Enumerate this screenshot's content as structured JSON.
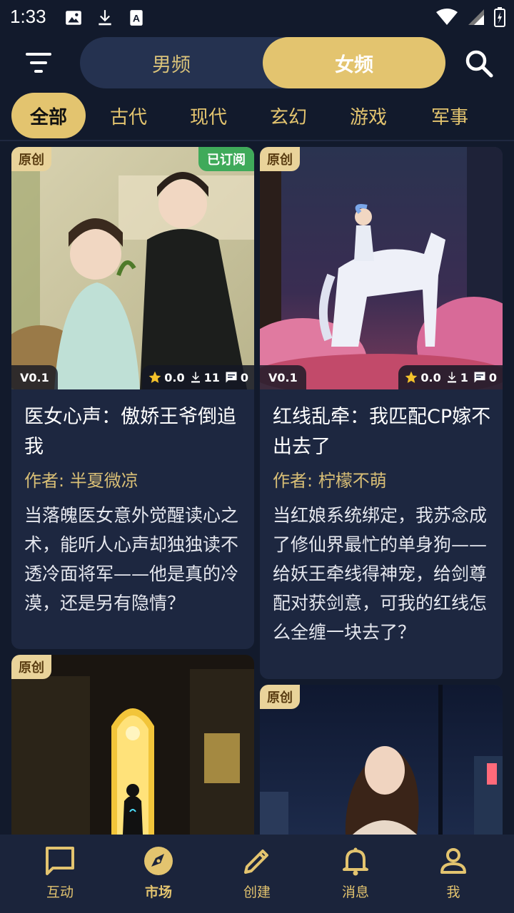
{
  "status": {
    "time": "1:33"
  },
  "colors": {
    "accent": "#e3c46f",
    "background": "#121a2c",
    "card": "#1d2740",
    "subscribed": "#3faa5a"
  },
  "header": {
    "tabs": [
      {
        "label": "男频"
      },
      {
        "label": "女频",
        "selected": true
      }
    ],
    "filter_icon": "filter-icon",
    "search_icon": "search-icon"
  },
  "categories": [
    {
      "label": "全部",
      "selected": true
    },
    {
      "label": "古代"
    },
    {
      "label": "现代"
    },
    {
      "label": "玄幻"
    },
    {
      "label": "游戏"
    },
    {
      "label": "军事"
    }
  ],
  "cards": [
    {
      "badge": "原创",
      "subscribed": "已订阅",
      "version": "V0.1",
      "rating": "0.0",
      "downloads": "11",
      "comments": "0",
      "title": "医女心声：傲娇王爷倒追我",
      "author": "作者: 半夏微凉",
      "desc": "当落魄医女意外觉醒读心之术，能听人心声却独独读不透冷面将军——他是真的冷漠，还是另有隐情？"
    },
    {
      "badge": "原创",
      "version": "V0.1",
      "rating": "0.0",
      "downloads": "1",
      "comments": "0",
      "title": "红线乱牵：我匹配CP嫁不出去了",
      "author": "作者: 柠檬不萌",
      "desc": "当红娘系统绑定，我苏念成了修仙界最忙的单身狗——给妖王牵线得神宠，给剑尊配对获剑意，可我的红线怎么全缠一块去了？"
    },
    {
      "badge": "原创"
    },
    {
      "badge": "原创"
    }
  ],
  "nav": [
    {
      "label": "互动",
      "icon": "chat-bubble-icon"
    },
    {
      "label": "市场",
      "icon": "compass-icon",
      "selected": true
    },
    {
      "label": "创建",
      "icon": "pencil-icon"
    },
    {
      "label": "消息",
      "icon": "bell-icon"
    },
    {
      "label": "我",
      "icon": "person-icon"
    }
  ]
}
